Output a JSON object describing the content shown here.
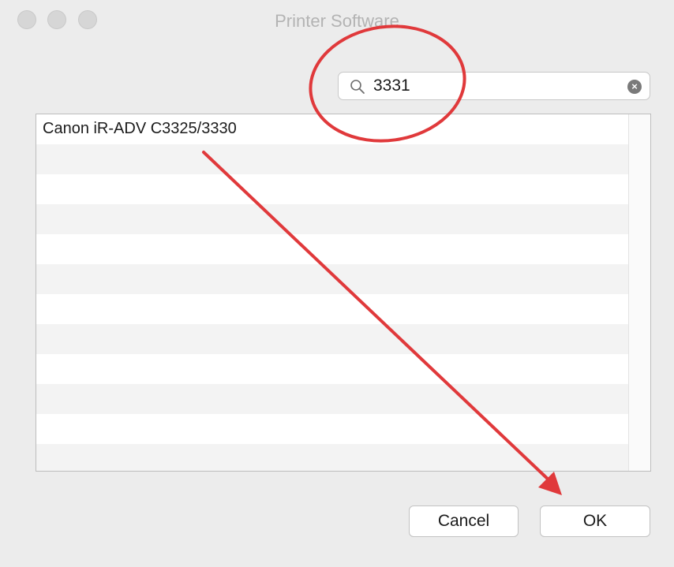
{
  "window": {
    "title": "Printer Software"
  },
  "search": {
    "value": "3331",
    "icon": "magnifier-icon",
    "clear_icon": "clear-icon"
  },
  "printer_list": {
    "items": [
      "Canon iR-ADV C3325/3330",
      "",
      "",
      "",
      "",
      "",
      "",
      "",
      "",
      "",
      "",
      "",
      ""
    ]
  },
  "buttons": {
    "cancel_label": "Cancel",
    "ok_label": "OK"
  },
  "colors": {
    "annotation": "#e0393b",
    "window_bg": "#ececec",
    "row_alt": "#f3f3f3"
  }
}
